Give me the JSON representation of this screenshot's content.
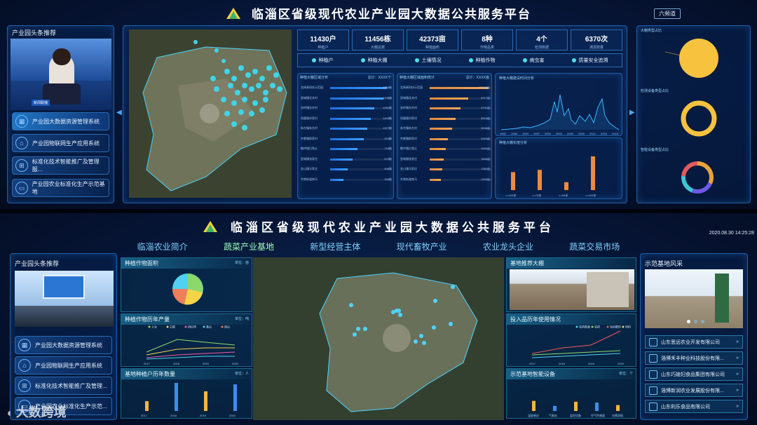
{
  "top": {
    "title": "临淄区省级现代农业产业园大数据公共服务平台",
    "channel_button": "六频道",
    "left_panel": {
      "title": "产业园头条推荐",
      "video_caption": "新闻联播",
      "menu": [
        {
          "label": "产业园大数据资源管理系统",
          "icon": "dashboard-icon"
        },
        {
          "label": "产业园物联网生产应用系统",
          "icon": "iot-icon"
        },
        {
          "label": "标准化技术智能推广及管理服...",
          "icon": "standard-icon"
        },
        {
          "label": "产业园农业标准化生产示范基地",
          "icon": "monitor-icon"
        }
      ]
    },
    "stats": [
      {
        "value": "11430户",
        "label": "种植户"
      },
      {
        "value": "11456栋",
        "label": "大棚总数"
      },
      {
        "value": "42373亩",
        "label": "种植面积"
      },
      {
        "value": "8种",
        "label": "作物品类"
      },
      {
        "value": "4个",
        "label": "检测数据"
      },
      {
        "value": "6370次",
        "label": "溯源数量"
      }
    ],
    "legend": [
      "种植户",
      "种植大棚",
      "土壤情况",
      "种植作物",
      "病虫害",
      "质量安全追溯"
    ],
    "bars_left": {
      "title": "种植大棚区域分布",
      "note": "总计：XXXX个",
      "rows": [
        {
          "label": "北杨高科技示范园",
          "value": "1863栋",
          "pct": 0.92
        },
        {
          "label": "皇城镇北关村",
          "value": "1705栋",
          "pct": 0.86
        },
        {
          "label": "金岭镇东孙村",
          "value": "1351栋",
          "pct": 0.72
        },
        {
          "label": "凤凰镇刘家村",
          "value": "1203栋",
          "pct": 0.66
        },
        {
          "label": "朱台镇朱台村",
          "value": "1077栋",
          "pct": 0.6
        },
        {
          "label": "齐都镇郎家村",
          "value": "970栋",
          "pct": 0.55
        },
        {
          "label": "敬仲镇白兔丘",
          "value": "715栋",
          "pct": 0.44
        },
        {
          "label": "皇城镇张家庄",
          "value": "573栋",
          "pct": 0.36
        },
        {
          "label": "金山镇马家庄",
          "value": "406栋",
          "pct": 0.28
        },
        {
          "label": "齐陵街道南马",
          "value": "330栋",
          "pct": 0.22
        }
      ]
    },
    "bars_right": {
      "title": "种植大棚区域面积统计",
      "note": "总计：XXXX亩",
      "rows": [
        {
          "label": "北杨高科技示范园",
          "value": "13410亩",
          "pct": 0.95
        },
        {
          "label": "皇城镇北关村",
          "value": "6377亩",
          "pct": 0.62
        },
        {
          "label": "金岭镇东孙村",
          "value": "4791亩",
          "pct": 0.5
        },
        {
          "label": "凤凰镇刘家村",
          "value": "3515亩",
          "pct": 0.42
        },
        {
          "label": "朱台镇朱台村",
          "value": "2636亩",
          "pct": 0.36
        },
        {
          "label": "齐都镇郎家村",
          "value": "2063亩",
          "pct": 0.3
        },
        {
          "label": "敬仲镇白兔丘",
          "value": "1622亩",
          "pct": 0.26
        },
        {
          "label": "皇城镇张家庄",
          "value": "1506亩",
          "pct": 0.23
        },
        {
          "label": "金山镇马家庄",
          "value": "1382亩",
          "pct": 0.2
        },
        {
          "label": "齐陵街道南马",
          "value": "1200亩",
          "pct": 0.18
        }
      ]
    },
    "line_title": "种植大棚建设时间分析",
    "line_x": [
      "1982",
      "1986",
      "1994",
      "1997",
      "2000",
      "2003",
      "2006",
      "2009",
      "2012",
      "2015",
      "2018"
    ],
    "bar_small_title": "种植大棚长度分析",
    "bar_small": {
      "categories": [
        "<=100米",
        "<=70米",
        "<=50米",
        ">=100米"
      ],
      "values": [
        32,
        36,
        14,
        60
      ]
    },
    "right_panel": {
      "pie1_title": "大棚类型占比",
      "pie2_title": "检测设备类型占比",
      "pie3_title": "智能设备类型占比"
    }
  },
  "bottom": {
    "title": "临淄区省级现代农业产业园大数据公共服务平台",
    "datetime": "2020.08.30  14:25:28",
    "nav": [
      "临淄农业简介",
      "蔬菜产业基地",
      "新型经营主体",
      "现代畜牧产业",
      "农业龙头企业",
      "蔬菜交易市场"
    ],
    "nav_active": 1,
    "left_panel": {
      "title": "产业园头条推荐",
      "menu": [
        "产业园大数据资源管理系统",
        "产业园物联网生产应用系统",
        "标准化技术智能推广及管理...",
        "产业园农业标准化生产示范..."
      ]
    },
    "crop_area": {
      "title": "种植作物面积",
      "unit": "单位：亩"
    },
    "yield": {
      "title": "种植作物历年产量",
      "unit": "单位：吨",
      "years": [
        "2017",
        "2018",
        "2019",
        "2020"
      ],
      "legend": [
        "土豆",
        "白菜",
        "西红柿",
        "黄瓜",
        "西瓜"
      ]
    },
    "growers": {
      "title": "基地种植户历年数量",
      "unit": "单位：人",
      "years": [
        "2017",
        "2018",
        "2019",
        "2020"
      ],
      "values": [
        0.35,
        1.0,
        0.7,
        0.95
      ]
    },
    "greenhouse": {
      "title": "基地推荐大棚"
    },
    "inputs": {
      "title": "投入品历年使用情况",
      "years": [
        "2017",
        "2018",
        "2019",
        "2020"
      ],
      "legend": [
        "农药数量",
        "农药",
        "有机肥料",
        "饲料"
      ]
    },
    "devices": {
      "title": "示范基地智能设备",
      "unit": "单位：个",
      "categories": [
        "温度感应",
        "气象站",
        "监控设备",
        "空气传感器",
        "虫情测报"
      ],
      "values": [
        0.6,
        0.3,
        0.55,
        0.5,
        0.35
      ]
    },
    "demo_base": {
      "title": "示范基地风采"
    },
    "companies": [
      "山东思远农业开发有限公司",
      "淄博禾丰种业科技股份有限...",
      "山东巧媳妇食品集团有限公司",
      "淄博新润农业发展股份有限...",
      "山东利乐食品有限公司"
    ],
    "watermark": "大数跨境"
  }
}
